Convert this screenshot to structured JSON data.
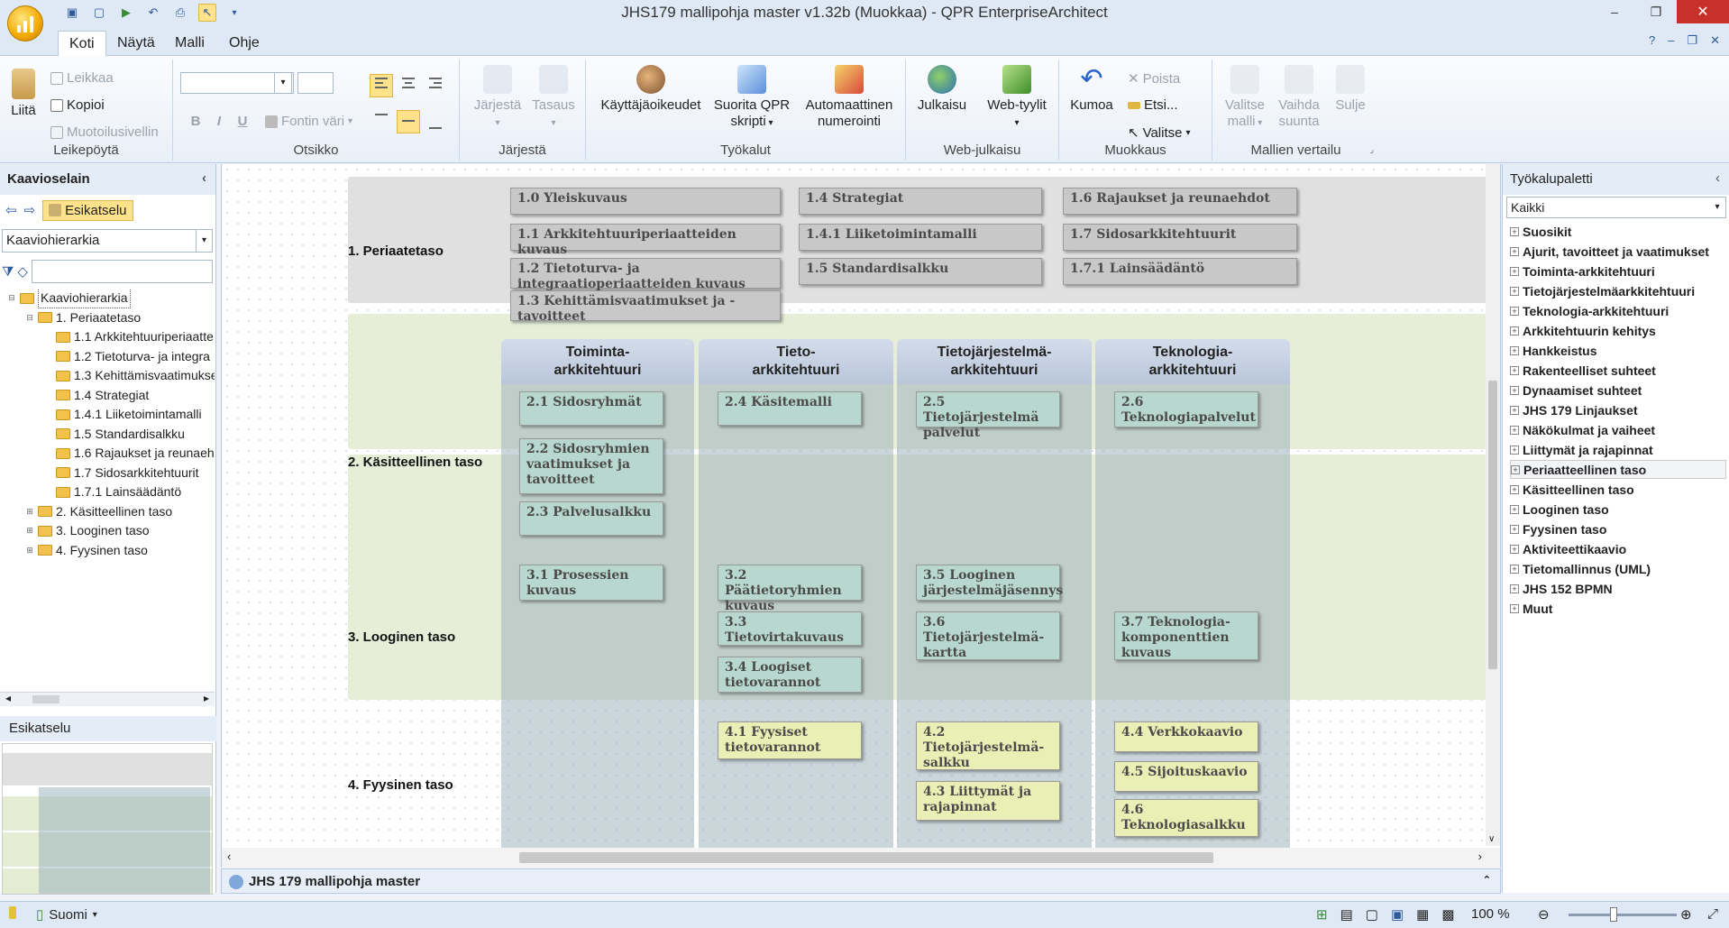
{
  "window": {
    "title": "JHS179 mallipohja master v1.32b (Muokkaa) - QPR EnterpriseArchitect",
    "controls": {
      "minimize": "–",
      "restore": "❐",
      "close": "✕"
    }
  },
  "tabs": [
    "Koti",
    "Näytä",
    "Malli",
    "Ohje"
  ],
  "ribbon": {
    "clipboard": {
      "paste": "Liitä",
      "cut": "Leikkaa",
      "copy": "Kopioi",
      "format_painter": "Muotoilusivellin",
      "label": "Leikepöytä"
    },
    "heading": {
      "font_color": "Fontin väri",
      "label": "Otsikko"
    },
    "arrange": {
      "arrange": "Järjestä",
      "align": "Tasaus",
      "label": "Järjestä"
    },
    "tools": {
      "user_rights": "Käyttäjäoikeudet",
      "run_script_1": "Suorita QPR",
      "run_script_2": "skripti",
      "auto_num_1": "Automaattinen",
      "auto_num_2": "numerointi",
      "label": "Työkalut"
    },
    "web": {
      "publish": "Julkaisu",
      "web_styles": "Web-tyylit",
      "label": "Web-julkaisu"
    },
    "edit": {
      "undo": "Kumoa",
      "delete": "Poista",
      "find": "Etsi...",
      "select": "Valitse",
      "label": "Muokkaus"
    },
    "compare": {
      "select_model_1": "Valitse",
      "select_model_2": "malli",
      "change_dir_1": "Vaihda",
      "change_dir_2": "suunta",
      "close": "Sulje",
      "label": "Mallien vertailu"
    }
  },
  "left_panel": {
    "title": "Kaavioselain",
    "preview_button": "Esikatselu",
    "hierarchy_select": "Kaaviohierarkia",
    "filter_placeholder": "",
    "tree": [
      {
        "label": "Kaaviohierarkia",
        "level": 0,
        "toggle": "⊟"
      },
      {
        "label": "1. Periaatetaso",
        "level": 1,
        "toggle": "⊟"
      },
      {
        "label": "1.1 Arkkitehtuuriperiaatte",
        "level": 2,
        "toggle": ""
      },
      {
        "label": "1.2 Tietoturva- ja integra",
        "level": 2,
        "toggle": ""
      },
      {
        "label": "1.3 Kehittämisvaatimukse",
        "level": 2,
        "toggle": ""
      },
      {
        "label": "1.4 Strategiat",
        "level": 2,
        "toggle": ""
      },
      {
        "label": "1.4.1 Liiketoimintamalli",
        "level": 2,
        "toggle": ""
      },
      {
        "label": "1.5 Standardisalkku",
        "level": 2,
        "toggle": ""
      },
      {
        "label": "1.6 Rajaukset ja reunaeh",
        "level": 2,
        "toggle": ""
      },
      {
        "label": "1.7 Sidosarkkitehtuurit",
        "level": 2,
        "toggle": ""
      },
      {
        "label": "1.7.1 Lainsäädäntö",
        "level": 2,
        "toggle": ""
      },
      {
        "label": "2. Käsitteellinen taso",
        "level": 1,
        "toggle": "⊞"
      },
      {
        "label": "3. Looginen taso",
        "level": 1,
        "toggle": "⊞"
      },
      {
        "label": "4. Fyysinen taso",
        "level": 1,
        "toggle": "⊞"
      }
    ],
    "preview_title": "Esikatselu"
  },
  "diagram": {
    "levels": [
      "1. Periaatetaso",
      "2. Käsitteellinen taso",
      "3. Looginen taso",
      "4. Fyysinen taso"
    ],
    "columns": [
      "Toiminta-\narkkitehtuuri",
      "Tieto-\narkkitehtuuri",
      "Tietojärjestelmä-\narkkitehtuuri",
      "Teknologia-\narkkitehtuuri"
    ],
    "level1_boxes": [
      "1.0 Yleiskuvaus",
      "1.1 Arkkitehtuuriperiaatteiden kuvaus",
      "1.2 Tietoturva- ja integraatioperiaatteiden kuvaus",
      "1.3 Kehittämisvaatimukset ja -tavoitteet",
      "1.4 Strategiat",
      "1.4.1 Liiketoimintamalli",
      "1.5 Standardisalkku",
      "1.6 Rajaukset ja reunaehdot",
      "1.7 Sidosarkkitehtuurit",
      "1.7.1 Lainsäädäntö"
    ],
    "level2_boxes": [
      "2.1 Sidosryhmät",
      "2.2 Sidosryhmien vaatimukset ja tavoitteet",
      "2.3 Palvelusalkku",
      "2.4 Käsitemalli",
      "2.5 Tietojärjestelmä palvelut",
      "2.6 Teknologiapalvelut"
    ],
    "level3_boxes": [
      "3.1 Prosessien kuvaus",
      "3.2 Päätietoryhmien kuvaus",
      "3.3 Tietovirtakuvaus",
      "3.4 Loogiset tietovarannot",
      "3.5 Looginen järjestelmäjäsennys",
      "3.6 Tietojärjestelmä-kartta",
      "3.7 Teknologia-komponenttien kuvaus"
    ],
    "level4_boxes": [
      "4.1 Fyysiset tietovarannot",
      "4.2 Tietojärjestelmä-salkku",
      "4.3 Liittymät ja rajapinnat",
      "4.4 Verkkokaavio",
      "4.5 Sijoituskaavio",
      "4.6 Teknologiasalkku"
    ]
  },
  "doc_tab": "JHS 179 mallipohja master",
  "right_panel": {
    "title": "Työkalupaletti",
    "filter": "Kaikki",
    "items": [
      "Suosikit",
      "Ajurit, tavoitteet ja vaatimukset",
      "Toiminta-arkkitehtuuri",
      "Tietojärjestelmäarkkitehtuuri",
      "Teknologia-arkkitehtuuri",
      "Arkkitehtuurin kehitys",
      "Hankkeistus",
      "Rakenteelliset suhteet",
      "Dynaamiset suhteet",
      "JHS 179 Linjaukset",
      "Näkökulmat ja vaiheet",
      "Liittymät ja rajapinnat",
      "Periaatteellinen taso",
      "Käsitteellinen taso",
      "Looginen taso",
      "Fyysinen taso",
      "Aktiviteettikaavio",
      "Tietomallinnus (UML)",
      "JHS 152 BPMN",
      "Muut"
    ],
    "selected_index": 12
  },
  "status": {
    "language": "Suomi",
    "zoom": "100 %"
  }
}
